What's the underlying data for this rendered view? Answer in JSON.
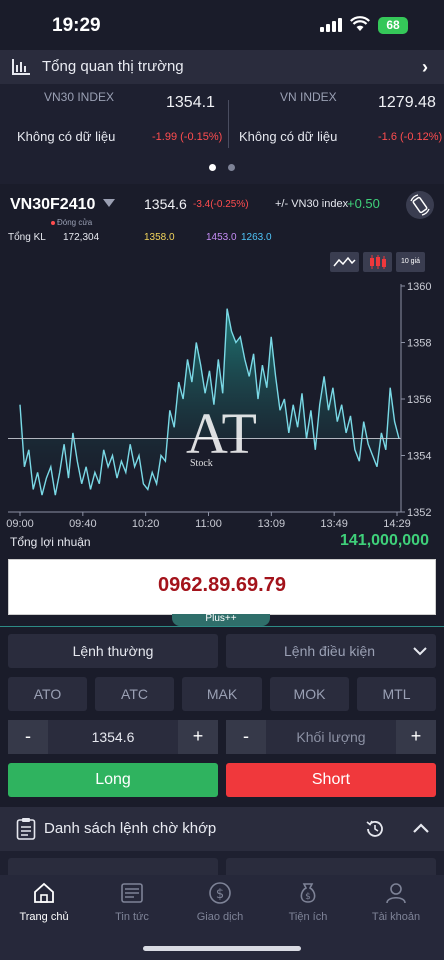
{
  "status_bar": {
    "time": "19:29",
    "battery": "68"
  },
  "overview": {
    "title": "Tổng quan thị trường"
  },
  "indexes": [
    {
      "name": "VN30 INDEX",
      "value": "1354.1",
      "no_data": "Không có dữ liệu",
      "change": "-1.99 (-0.15%)"
    },
    {
      "name": "VN INDEX",
      "value": "1279.48",
      "no_data": "Không có dữ liệu",
      "change": "-1.6 (-0.12%)"
    }
  ],
  "contract": {
    "symbol": "VN30F2410",
    "status": "Đóng cửa",
    "price": "1354.6",
    "change": "-3.4(-0.25%)",
    "vs_label": "+/- VN30 index",
    "vs_value": "+0.50",
    "volume_label": "Tổng KL",
    "volume": "172,304",
    "levels": [
      {
        "value": "1358.0",
        "color": "#f2d45c"
      },
      {
        "value": "1453.0",
        "color": "#c58cf5"
      },
      {
        "value": "1263.0",
        "color": "#4fc3f7"
      }
    ],
    "view_10_label": "10 giá"
  },
  "chart_data": {
    "type": "area",
    "x_ticks": [
      "09:00",
      "09:40",
      "10:20",
      "11:00",
      "13:09",
      "13:49",
      "14:29"
    ],
    "y_ticks": [
      "1360",
      "1358",
      "1356",
      "1354",
      "1352"
    ],
    "ylim": [
      1352,
      1360
    ],
    "reference": 1354.6,
    "values": [
      1355.8,
      1353.6,
      1354.2,
      1352.8,
      1353.4,
      1352.6,
      1353.2,
      1353.6,
      1352.6,
      1353.4,
      1354.4,
      1353.2,
      1354.8,
      1353.8,
      1353.0,
      1353.6,
      1352.8,
      1353.4,
      1353.0,
      1354.2,
      1353.6,
      1354.0,
      1353.2,
      1353.8,
      1353.4,
      1354.4,
      1353.6,
      1354.0,
      1353.0,
      1352.8,
      1353.4,
      1353.0,
      1354.0,
      1353.8,
      1355.6,
      1355.0,
      1356.6,
      1356.0,
      1357.4,
      1356.6,
      1358.0,
      1357.2,
      1356.2,
      1357.0,
      1355.8,
      1357.4,
      1356.2,
      1359.2,
      1358.4,
      1358.0,
      1358.2,
      1357.4,
      1356.8,
      1357.6,
      1356.0,
      1357.2,
      1356.4,
      1358.2,
      1356.8,
      1355.6,
      1356.0,
      1354.8,
      1355.8,
      1355.0,
      1356.2,
      1354.6,
      1355.6,
      1354.2,
      1355.8,
      1356.8,
      1355.6,
      1356.4,
      1355.2,
      1355.8,
      1354.8,
      1355.4,
      1354.2,
      1353.8,
      1355.2,
      1354.4,
      1354.0,
      1353.6,
      1354.8,
      1354.2,
      1356.4,
      1355.2,
      1354.6
    ],
    "watermark": "AT",
    "watermark_sub": "Stock"
  },
  "profit": {
    "label": "Tổng lợi nhuận",
    "value": "141,000,000"
  },
  "banner": {
    "phone": "0962.89.69.79",
    "tab": "Plus++"
  },
  "order": {
    "tabs": [
      {
        "label": "Lệnh thường"
      },
      {
        "label": "Lệnh điều kiện"
      }
    ],
    "types": [
      "ATO",
      "ATC",
      "MAK",
      "MOK",
      "MTL"
    ],
    "price": "1354.6",
    "quantity_placeholder": "Khối lượng",
    "long_label": "Long",
    "short_label": "Short"
  },
  "pending": {
    "title": "Danh sách lệnh chờ khớp"
  },
  "nav": [
    {
      "label": "Trang chủ",
      "icon": "home-icon"
    },
    {
      "label": "Tin tức",
      "icon": "news-icon"
    },
    {
      "label": "Giao dịch",
      "icon": "trade-icon"
    },
    {
      "label": "Tiện ích",
      "icon": "utility-icon"
    },
    {
      "label": "Tài khoản",
      "icon": "account-icon"
    }
  ]
}
